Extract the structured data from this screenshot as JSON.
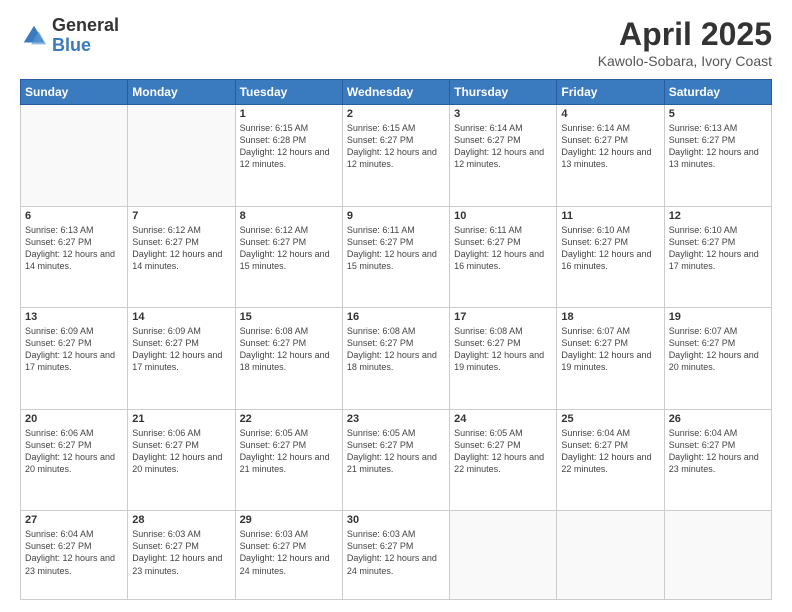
{
  "logo": {
    "general": "General",
    "blue": "Blue"
  },
  "header": {
    "title": "April 2025",
    "location": "Kawolo-Sobara, Ivory Coast"
  },
  "weekdays": [
    "Sunday",
    "Monday",
    "Tuesday",
    "Wednesday",
    "Thursday",
    "Friday",
    "Saturday"
  ],
  "weeks": [
    [
      {
        "day": "",
        "sunrise": "",
        "sunset": "",
        "daylight": ""
      },
      {
        "day": "",
        "sunrise": "",
        "sunset": "",
        "daylight": ""
      },
      {
        "day": "1",
        "sunrise": "Sunrise: 6:15 AM",
        "sunset": "Sunset: 6:28 PM",
        "daylight": "Daylight: 12 hours and 12 minutes."
      },
      {
        "day": "2",
        "sunrise": "Sunrise: 6:15 AM",
        "sunset": "Sunset: 6:27 PM",
        "daylight": "Daylight: 12 hours and 12 minutes."
      },
      {
        "day": "3",
        "sunrise": "Sunrise: 6:14 AM",
        "sunset": "Sunset: 6:27 PM",
        "daylight": "Daylight: 12 hours and 12 minutes."
      },
      {
        "day": "4",
        "sunrise": "Sunrise: 6:14 AM",
        "sunset": "Sunset: 6:27 PM",
        "daylight": "Daylight: 12 hours and 13 minutes."
      },
      {
        "day": "5",
        "sunrise": "Sunrise: 6:13 AM",
        "sunset": "Sunset: 6:27 PM",
        "daylight": "Daylight: 12 hours and 13 minutes."
      }
    ],
    [
      {
        "day": "6",
        "sunrise": "Sunrise: 6:13 AM",
        "sunset": "Sunset: 6:27 PM",
        "daylight": "Daylight: 12 hours and 14 minutes."
      },
      {
        "day": "7",
        "sunrise": "Sunrise: 6:12 AM",
        "sunset": "Sunset: 6:27 PM",
        "daylight": "Daylight: 12 hours and 14 minutes."
      },
      {
        "day": "8",
        "sunrise": "Sunrise: 6:12 AM",
        "sunset": "Sunset: 6:27 PM",
        "daylight": "Daylight: 12 hours and 15 minutes."
      },
      {
        "day": "9",
        "sunrise": "Sunrise: 6:11 AM",
        "sunset": "Sunset: 6:27 PM",
        "daylight": "Daylight: 12 hours and 15 minutes."
      },
      {
        "day": "10",
        "sunrise": "Sunrise: 6:11 AM",
        "sunset": "Sunset: 6:27 PM",
        "daylight": "Daylight: 12 hours and 16 minutes."
      },
      {
        "day": "11",
        "sunrise": "Sunrise: 6:10 AM",
        "sunset": "Sunset: 6:27 PM",
        "daylight": "Daylight: 12 hours and 16 minutes."
      },
      {
        "day": "12",
        "sunrise": "Sunrise: 6:10 AM",
        "sunset": "Sunset: 6:27 PM",
        "daylight": "Daylight: 12 hours and 17 minutes."
      }
    ],
    [
      {
        "day": "13",
        "sunrise": "Sunrise: 6:09 AM",
        "sunset": "Sunset: 6:27 PM",
        "daylight": "Daylight: 12 hours and 17 minutes."
      },
      {
        "day": "14",
        "sunrise": "Sunrise: 6:09 AM",
        "sunset": "Sunset: 6:27 PM",
        "daylight": "Daylight: 12 hours and 17 minutes."
      },
      {
        "day": "15",
        "sunrise": "Sunrise: 6:08 AM",
        "sunset": "Sunset: 6:27 PM",
        "daylight": "Daylight: 12 hours and 18 minutes."
      },
      {
        "day": "16",
        "sunrise": "Sunrise: 6:08 AM",
        "sunset": "Sunset: 6:27 PM",
        "daylight": "Daylight: 12 hours and 18 minutes."
      },
      {
        "day": "17",
        "sunrise": "Sunrise: 6:08 AM",
        "sunset": "Sunset: 6:27 PM",
        "daylight": "Daylight: 12 hours and 19 minutes."
      },
      {
        "day": "18",
        "sunrise": "Sunrise: 6:07 AM",
        "sunset": "Sunset: 6:27 PM",
        "daylight": "Daylight: 12 hours and 19 minutes."
      },
      {
        "day": "19",
        "sunrise": "Sunrise: 6:07 AM",
        "sunset": "Sunset: 6:27 PM",
        "daylight": "Daylight: 12 hours and 20 minutes."
      }
    ],
    [
      {
        "day": "20",
        "sunrise": "Sunrise: 6:06 AM",
        "sunset": "Sunset: 6:27 PM",
        "daylight": "Daylight: 12 hours and 20 minutes."
      },
      {
        "day": "21",
        "sunrise": "Sunrise: 6:06 AM",
        "sunset": "Sunset: 6:27 PM",
        "daylight": "Daylight: 12 hours and 20 minutes."
      },
      {
        "day": "22",
        "sunrise": "Sunrise: 6:05 AM",
        "sunset": "Sunset: 6:27 PM",
        "daylight": "Daylight: 12 hours and 21 minutes."
      },
      {
        "day": "23",
        "sunrise": "Sunrise: 6:05 AM",
        "sunset": "Sunset: 6:27 PM",
        "daylight": "Daylight: 12 hours and 21 minutes."
      },
      {
        "day": "24",
        "sunrise": "Sunrise: 6:05 AM",
        "sunset": "Sunset: 6:27 PM",
        "daylight": "Daylight: 12 hours and 22 minutes."
      },
      {
        "day": "25",
        "sunrise": "Sunrise: 6:04 AM",
        "sunset": "Sunset: 6:27 PM",
        "daylight": "Daylight: 12 hours and 22 minutes."
      },
      {
        "day": "26",
        "sunrise": "Sunrise: 6:04 AM",
        "sunset": "Sunset: 6:27 PM",
        "daylight": "Daylight: 12 hours and 23 minutes."
      }
    ],
    [
      {
        "day": "27",
        "sunrise": "Sunrise: 6:04 AM",
        "sunset": "Sunset: 6:27 PM",
        "daylight": "Daylight: 12 hours and 23 minutes."
      },
      {
        "day": "28",
        "sunrise": "Sunrise: 6:03 AM",
        "sunset": "Sunset: 6:27 PM",
        "daylight": "Daylight: 12 hours and 23 minutes."
      },
      {
        "day": "29",
        "sunrise": "Sunrise: 6:03 AM",
        "sunset": "Sunset: 6:27 PM",
        "daylight": "Daylight: 12 hours and 24 minutes."
      },
      {
        "day": "30",
        "sunrise": "Sunrise: 6:03 AM",
        "sunset": "Sunset: 6:27 PM",
        "daylight": "Daylight: 12 hours and 24 minutes."
      },
      {
        "day": "",
        "sunrise": "",
        "sunset": "",
        "daylight": ""
      },
      {
        "day": "",
        "sunrise": "",
        "sunset": "",
        "daylight": ""
      },
      {
        "day": "",
        "sunrise": "",
        "sunset": "",
        "daylight": ""
      }
    ]
  ]
}
